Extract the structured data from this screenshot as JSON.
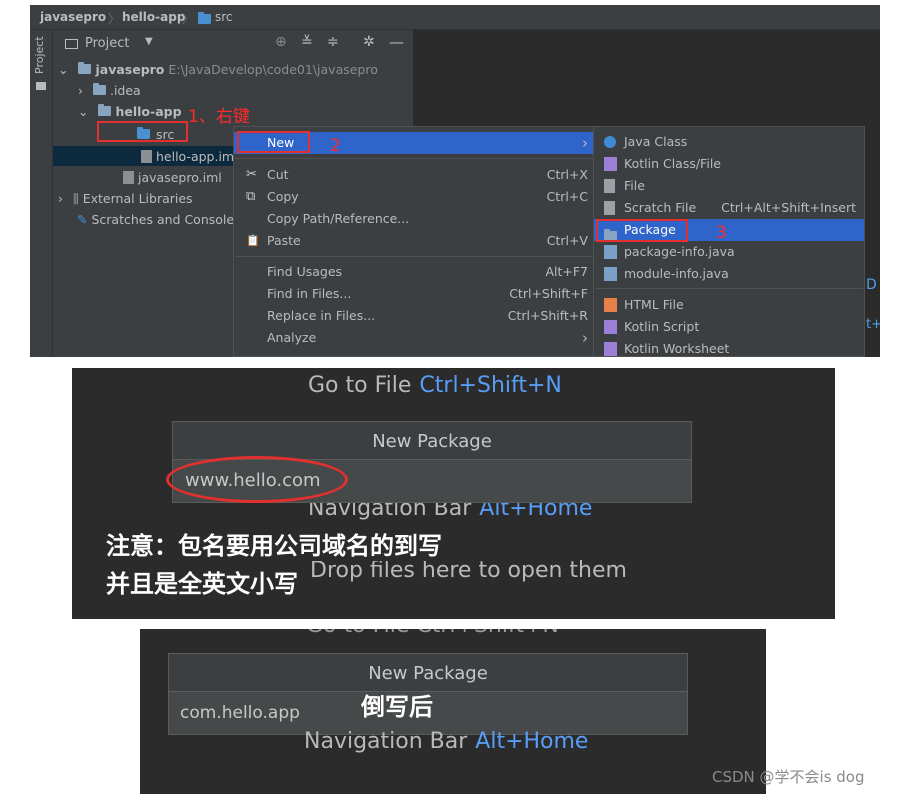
{
  "ide": {
    "breadcrumb": [
      "javasepro",
      "hello-app",
      "src"
    ],
    "side_tab": "Project",
    "project_view_label": "Project",
    "toolbar_icons": [
      "locate-icon",
      "expand-all-icon",
      "collapse-all-icon",
      "gear-icon",
      "minimize-icon"
    ],
    "tree": {
      "root_name": "javasepro",
      "root_path": "E:\\JavaDevelop\\code01\\javasepro",
      "idea": ".idea",
      "module": "hello-app",
      "src": "src",
      "module_iml": "hello-app.iml",
      "root_iml": "javasepro.iml",
      "external_libraries": "External Libraries",
      "scratches": "Scratches and Consoles"
    },
    "annotations": {
      "step1": "1、右键",
      "step2": "2",
      "step3": "3"
    },
    "context_menu": [
      {
        "label": "New",
        "shortcut": "",
        "arrow": "›",
        "icon": ""
      },
      {
        "label": "Cut",
        "shortcut": "Ctrl+X",
        "icon": "✂"
      },
      {
        "label": "Copy",
        "shortcut": "Ctrl+C",
        "icon": "⧉"
      },
      {
        "label": "Copy Path/Reference...",
        "shortcut": "",
        "icon": ""
      },
      {
        "label": "Paste",
        "shortcut": "Ctrl+V",
        "icon": "📋"
      },
      {
        "label": "Find Usages",
        "shortcut": "Alt+F7",
        "icon": ""
      },
      {
        "label": "Find in Files...",
        "shortcut": "Ctrl+Shift+F",
        "icon": ""
      },
      {
        "label": "Replace in Files...",
        "shortcut": "Ctrl+Shift+R",
        "icon": ""
      },
      {
        "label": "Analyze",
        "shortcut": "",
        "arrow": "›",
        "icon": ""
      }
    ],
    "submenu": [
      {
        "label": "Java Class",
        "shortcut": "",
        "color": "#3d8ad5"
      },
      {
        "label": "Kotlin Class/File",
        "shortcut": "",
        "color": "#9b7fd9"
      },
      {
        "label": "File",
        "shortcut": "",
        "color": "#9aa0a6"
      },
      {
        "label": "Scratch File",
        "shortcut": "Ctrl+Alt+Shift+Insert",
        "color": "#9aa0a6"
      },
      {
        "label": "Package",
        "shortcut": "",
        "color": "#88a4c0"
      },
      {
        "label": "package-info.java",
        "shortcut": "",
        "color": "#7aa0c8"
      },
      {
        "label": "module-info.java",
        "shortcut": "",
        "color": "#7aa0c8"
      },
      {
        "label": "HTML File",
        "shortcut": "",
        "color": "#e8804a"
      },
      {
        "label": "Kotlin Script",
        "shortcut": "",
        "color": "#9b7fd9"
      },
      {
        "label": "Kotlin Worksheet",
        "shortcut": "",
        "color": "#9b7fd9"
      }
    ],
    "edge_text": [
      "D",
      "t+"
    ]
  },
  "panel2": {
    "hint_top_label": "Go to File",
    "hint_top_key": "Ctrl+Shift+N",
    "dialog_title": "New Package",
    "input_value": "www.hello.com",
    "hint_mid_label": "Navigation Bar",
    "hint_mid_key": "Alt+Home",
    "hint_bottom": "Drop files here to open them",
    "note_line1": "注意：包名要用公司域名的到写",
    "note_line2": "并且是全英文小写"
  },
  "panel3": {
    "hint_top_partial": "Go to File  Ctrl+Shift+N",
    "dialog_title": "New Package",
    "input_value": "com.hello.app",
    "note": "倒写后",
    "hint_label": "Navigation Bar",
    "hint_key": "Alt+Home"
  },
  "watermark": "CSDN @学不会is dog",
  "colors": {
    "accent": "#2f65ca",
    "annotation_red": "#e3302f",
    "shortcut_blue": "#589df6"
  }
}
